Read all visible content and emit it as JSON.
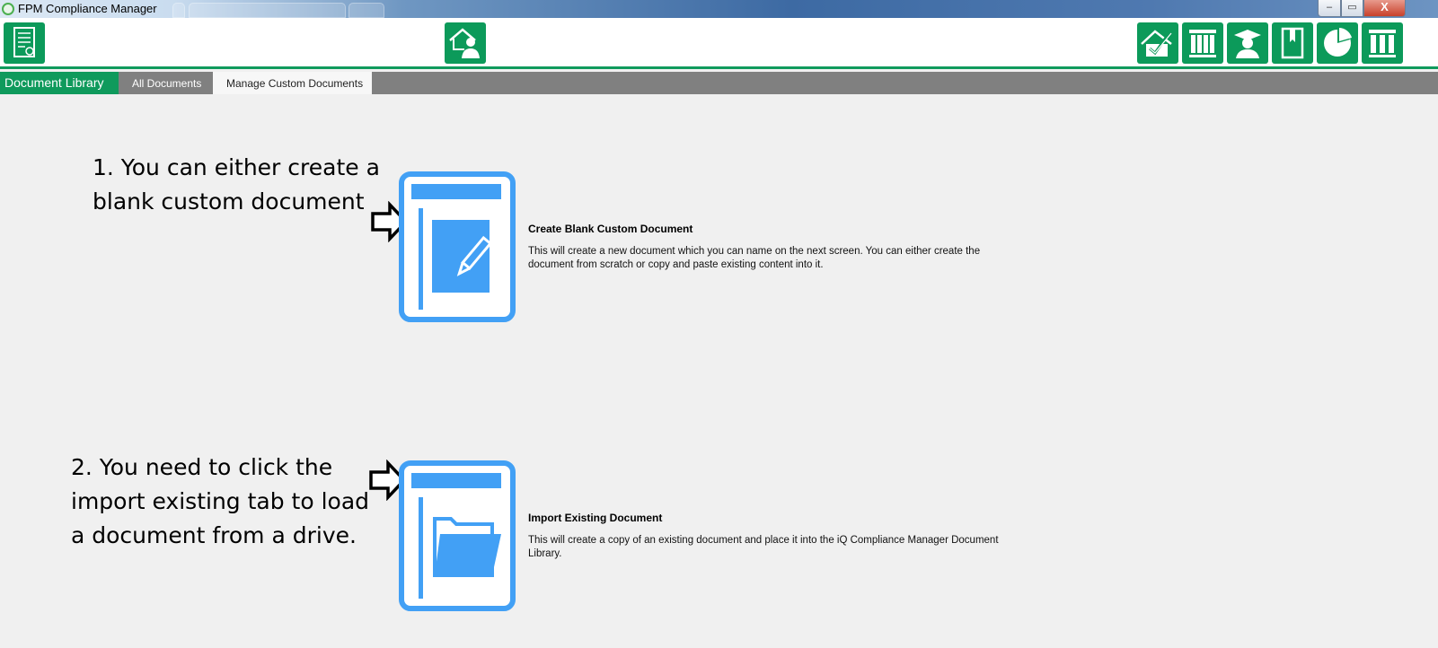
{
  "window": {
    "title": "FPM Compliance Manager",
    "controls": {
      "minimize": "–",
      "maximize": "▭",
      "close": "X"
    }
  },
  "toolbar": {
    "left_icon": "document-certificate-icon",
    "center_icon": "home-user-icon",
    "right_icons": [
      "house-check-icon",
      "book-shelf-icon",
      "graduate-icon",
      "bookmark-icon",
      "pie-chart-icon",
      "library-icon"
    ]
  },
  "tabs": {
    "section": "Document Library",
    "items": [
      {
        "label": "All Documents"
      },
      {
        "label": "Manage Custom Documents"
      }
    ]
  },
  "annotations": {
    "first": "1. You can either create a blank custom document",
    "second": "2. You need to click the import existing tab to load a document from a drive."
  },
  "options": {
    "create": {
      "title": "Create Blank Custom Document",
      "description": "This will create a new document which you can name on the next screen. You can either create the document from scratch or copy and paste existing content into it."
    },
    "import": {
      "title": "Import Existing Document",
      "description": "This will create a copy of an existing document and place it into the iQ Compliance Manager Document Library."
    }
  },
  "colors": {
    "brand_green": "#0c9a5a",
    "icon_blue": "#42a0f5",
    "tab_gray": "#808080"
  }
}
